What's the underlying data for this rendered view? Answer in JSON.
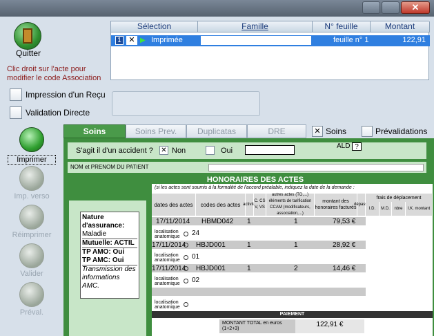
{
  "window": {
    "close_label": "✕"
  },
  "left_panel": {
    "quit_label": "Quitter",
    "hint": "Clic droit sur l'acte pour modifier le code Association",
    "receipt_label": "Impression d'un Reçu",
    "direct_validation_label": "Validation Directe",
    "buttons": [
      {
        "label": "Imprimer",
        "active": true
      },
      {
        "label": "Imp. verso",
        "active": false
      },
      {
        "label": "Réimprimer",
        "active": false
      },
      {
        "label": "Valider",
        "active": false
      },
      {
        "label": "Préval.",
        "active": false
      }
    ]
  },
  "selection_table": {
    "headers": [
      "Sélection",
      "Famille",
      "N° feuille",
      "Montant"
    ],
    "rows": [
      {
        "num": "1",
        "type": "Imprimée",
        "famille": "",
        "feuille": "feuille n° 1",
        "montant": "122,91"
      }
    ]
  },
  "tabs": {
    "items": [
      "Soins",
      "Soins Prev.",
      "Duplicatas",
      "DRE"
    ],
    "active": "Soins",
    "check_soins": "Soins",
    "check_prevalidations": "Prévalidations"
  },
  "form": {
    "accident_question": "S'agit il d'un accident ?",
    "non_label": "Non",
    "oui_label": "Oui",
    "ald_label": "ALD",
    "ald_help": "?",
    "patient_label": "NOM et PRENOM DU PATIENT",
    "honoraires_title": "HONORAIRES DES ACTES",
    "honoraires_note": "(si les actes sont soumis à la formalité de l'accord préalable, indiquez la date de la demande :",
    "columns": {
      "date": "dates des actes",
      "codes": "codes des actes",
      "activite": "activité",
      "cs": "C. CS V, VS",
      "autres": "autres actes (TO,...) éléments de tarification CCAM (modificateurs, association,...)",
      "montant": "montant des honoraires facturés",
      "depass": "dépass.",
      "frais": "frais de déplacement",
      "id": "I.D.",
      "md": "M.D.",
      "nbre": "nbre",
      "ik": "I.K. montant"
    },
    "rows": [
      {
        "date": "17/11/2014",
        "code": "HBMD042",
        "activite": "1",
        "autres": "1",
        "montant": "79,53 €",
        "loc": "24"
      },
      {
        "date": "17/11/2014",
        "code": "HBJD001",
        "activite": "1",
        "autres": "1",
        "montant": "28,92 €",
        "loc": "01"
      },
      {
        "date": "17/11/2014",
        "code": "HBJD001",
        "activite": "1",
        "autres": "2",
        "montant": "14,46 €",
        "loc": "02"
      }
    ],
    "localisation_label": "localisation anatomique",
    "paiement_title": "PAIEMENT",
    "total_label": "MONTANT TOTAL en euros (1+2+3)",
    "total_value": "122,91 €"
  },
  "insurance": {
    "nature_label": "Nature d'assurance:",
    "nature_value": "Maladie",
    "mutuelle": "Mutuelle: ACTIL",
    "tp_amo": "TP AMO: Oui",
    "tp_amc": "TP AMC: Oui",
    "transmission": "Transmission des informations AMC."
  }
}
